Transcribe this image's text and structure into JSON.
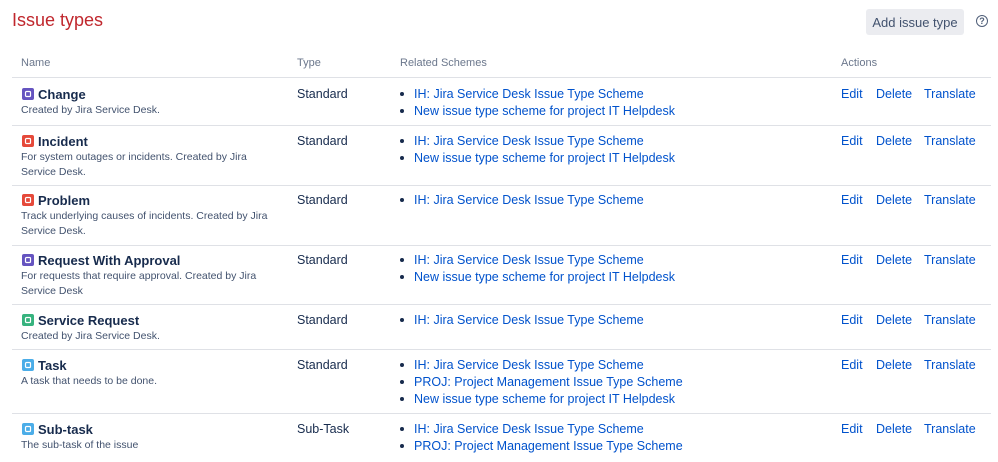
{
  "page": {
    "title": "Issue types",
    "add_button": "Add issue type",
    "help_icon": "?"
  },
  "table": {
    "headers": {
      "name": "Name",
      "type": "Type",
      "schemes": "Related Schemes",
      "actions": "Actions"
    },
    "actions": {
      "edit": "Edit",
      "delete": "Delete",
      "translate": "Translate"
    },
    "rows": [
      {
        "name": "Change",
        "icon": "change-icon",
        "color": "#6554c0",
        "desc": "Created by Jira Service Desk.",
        "type": "Standard",
        "schemes": [
          "IH: Jira Service Desk Issue Type Scheme",
          "New issue type scheme for project IT Helpdesk"
        ]
      },
      {
        "name": "Incident",
        "icon": "incident-icon",
        "color": "#e5493a",
        "desc": "For system outages or incidents. Created by Jira Service Desk.",
        "type": "Standard",
        "schemes": [
          "IH: Jira Service Desk Issue Type Scheme",
          "New issue type scheme for project IT Helpdesk"
        ]
      },
      {
        "name": "Problem",
        "icon": "problem-icon",
        "color": "#e5493a",
        "desc": "Track underlying causes of incidents. Created by Jira Service Desk.",
        "type": "Standard",
        "schemes": [
          "IH: Jira Service Desk Issue Type Scheme"
        ]
      },
      {
        "name": "Request With Approval",
        "icon": "request-approval-icon",
        "color": "#6554c0",
        "desc": "For requests that require approval. Created by Jira Service Desk",
        "type": "Standard",
        "schemes": [
          "IH: Jira Service Desk Issue Type Scheme",
          "New issue type scheme for project IT Helpdesk"
        ]
      },
      {
        "name": "Service Request",
        "icon": "service-request-icon",
        "color": "#36b37e",
        "desc": "Created by Jira Service Desk.",
        "type": "Standard",
        "schemes": [
          "IH: Jira Service Desk Issue Type Scheme"
        ]
      },
      {
        "name": "Task",
        "icon": "task-icon",
        "color": "#4bade8",
        "desc": "A task that needs to be done.",
        "type": "Standard",
        "schemes": [
          "IH: Jira Service Desk Issue Type Scheme",
          "PROJ: Project Management Issue Type Scheme",
          "New issue type scheme for project IT Helpdesk"
        ]
      },
      {
        "name": "Sub-task",
        "icon": "subtask-icon",
        "color": "#4bade8",
        "desc": "The sub-task of the issue",
        "type": "Sub-Task",
        "schemes": [
          "IH: Jira Service Desk Issue Type Scheme",
          "PROJ: Project Management Issue Type Scheme"
        ]
      }
    ]
  }
}
